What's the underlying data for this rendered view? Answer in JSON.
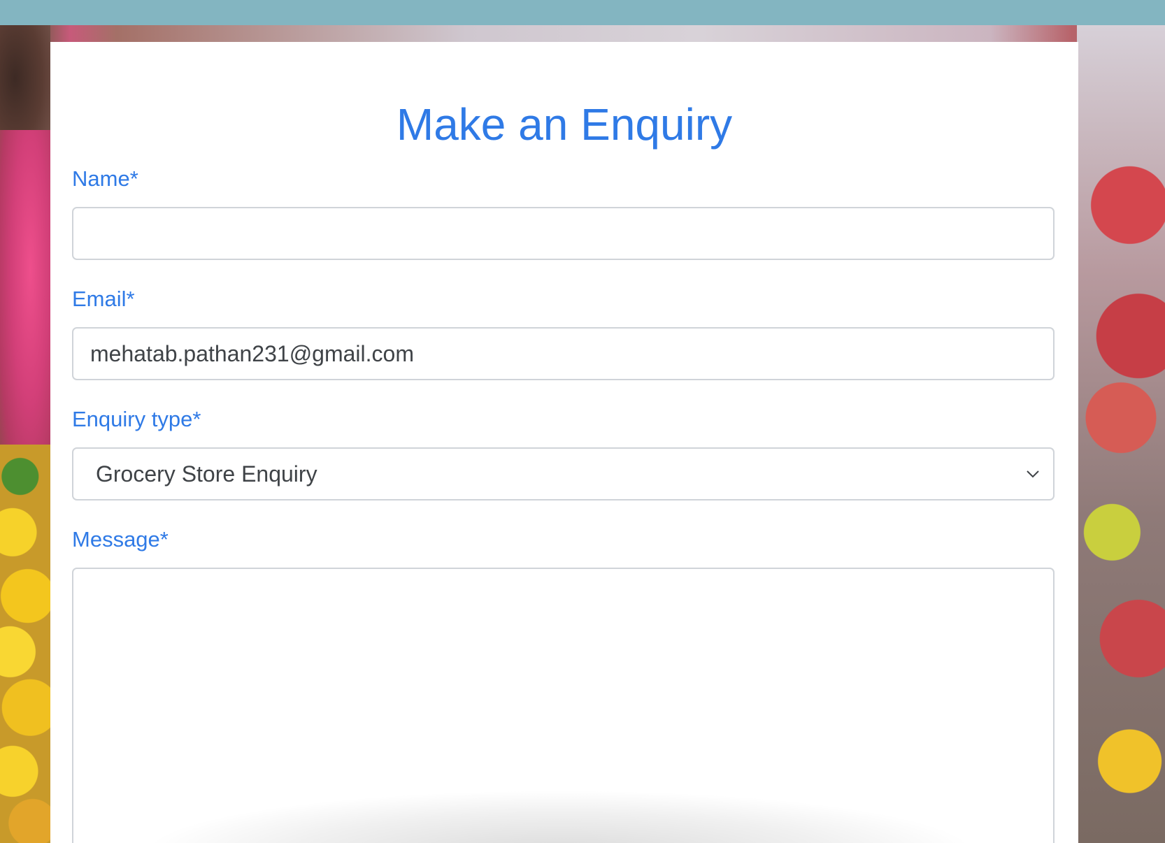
{
  "form": {
    "title": "Make an Enquiry",
    "name": {
      "label": "Name*",
      "value": ""
    },
    "email": {
      "label": "Email*",
      "value": "mehatab.pathan231@gmail.com"
    },
    "enquiry_type": {
      "label": "Enquiry type*",
      "selected": "Grocery Store Enquiry"
    },
    "message": {
      "label": "Message*",
      "value": ""
    }
  },
  "icons": {
    "select_arrow": "chevron-down-icon"
  },
  "colors": {
    "accent": "#2f7ae6",
    "top_bar": "#83b5c1",
    "field_border": "#d0d4d9",
    "field_text": "#3f4347"
  }
}
